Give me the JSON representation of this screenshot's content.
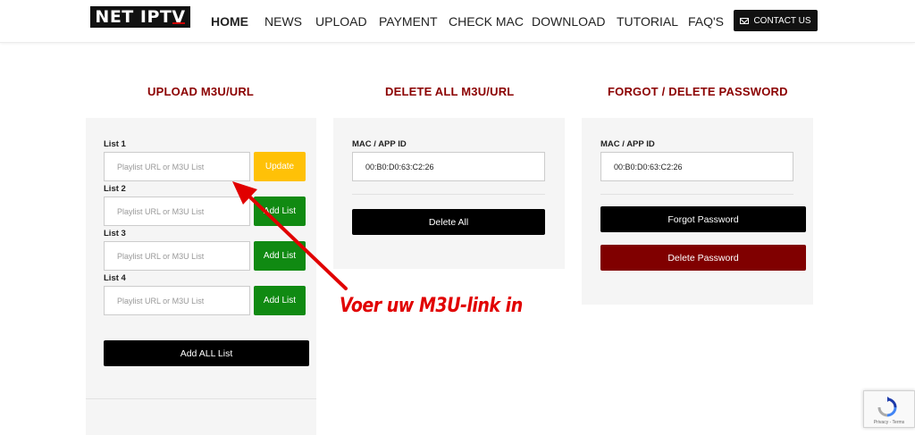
{
  "header": {
    "logo_text": "NET IPT",
    "logo_last": "V",
    "nav": [
      "HOME",
      "NEWS",
      "UPLOAD",
      "PAYMENT",
      "CHECK MAC",
      "DOWNLOAD",
      "TUTORIAL",
      "FAQ'S"
    ],
    "active": "HOME",
    "contact_label": "CONTACT US"
  },
  "upload": {
    "title": "UPLOAD M3U/URL",
    "lists": [
      {
        "label": "List 1",
        "placeholder": "Playlist URL or M3U List",
        "button": "Update"
      },
      {
        "label": "List 2",
        "placeholder": "Playlist URL or M3U List",
        "button": "Add List"
      },
      {
        "label": "List 3",
        "placeholder": "Playlist URL or M3U List",
        "button": "Add List"
      },
      {
        "label": "List 4",
        "placeholder": "Playlist URL or M3U List",
        "button": "Add List"
      }
    ],
    "add_all": "Add ALL List"
  },
  "delete_all": {
    "title": "DELETE ALL M3U/URL",
    "mac_label": "MAC / APP ID",
    "mac_value": "00:B0:D0:63:C2:26",
    "button": "Delete All"
  },
  "password": {
    "title": "FORGOT / DELETE PASSWORD",
    "mac_label": "MAC / APP ID",
    "mac_value": "00:B0:D0:63:C2:26",
    "forgot_button": "Forgot Password",
    "delete_button": "Delete Password"
  },
  "annotation": "Voer uw M3U-link in",
  "recaptcha": {
    "links": "Privacy - Terms"
  },
  "colors": {
    "accent_title": "#8b0000",
    "update_button": "#ffc107",
    "add_button": "#108a12",
    "delete_password": "#800000",
    "arrow": "#e10000"
  }
}
